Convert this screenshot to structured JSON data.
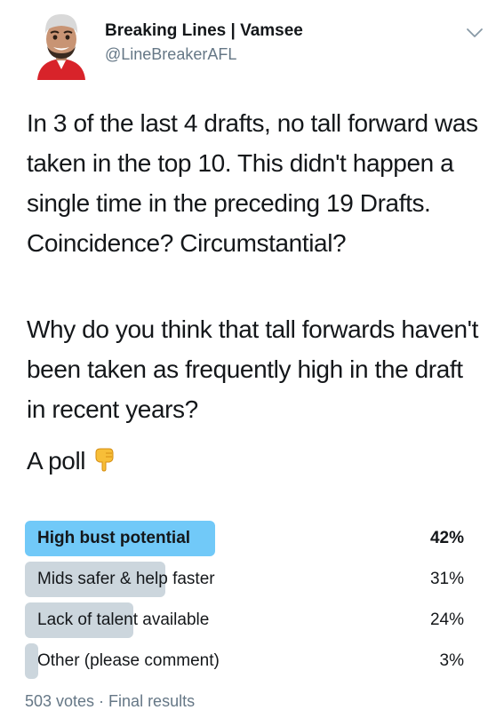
{
  "author": {
    "display_name": "Breaking Lines | Vamsee",
    "handle": "@LineBreakerAFL",
    "avatar_icon": "cartoon-avatar-icon"
  },
  "menu_icon": "chevron-down-icon",
  "tweet": {
    "paragraph_1": "In 3 of the last 4 drafts, no tall forward was taken in the top 10. This didn't happen a single time in the preceding 19 Drafts. Coincidence? Circumstantial?",
    "paragraph_2": "Why do you think that tall forwards haven't been taken as frequently high in the draft in recent years?",
    "paragraph_3": "A poll",
    "emoji_icon": "pointing-down-hand-icon"
  },
  "poll": {
    "options": [
      {
        "label": "High bust potential",
        "percent_label": "42%",
        "fraction": 0.42,
        "winner": true
      },
      {
        "label": "Mids safer & help faster",
        "percent_label": "31%",
        "fraction": 0.31,
        "winner": false
      },
      {
        "label": "Lack of talent available",
        "percent_label": "24%",
        "fraction": 0.24,
        "winner": false
      },
      {
        "label": "Other (please comment)",
        "percent_label": "3%",
        "fraction": 0.03,
        "winner": false
      }
    ],
    "footer": "503 votes · Final results"
  },
  "colors": {
    "winner_bar": "#71c9f8",
    "other_bar": "#ccd6dd",
    "secondary_text": "#657786"
  }
}
